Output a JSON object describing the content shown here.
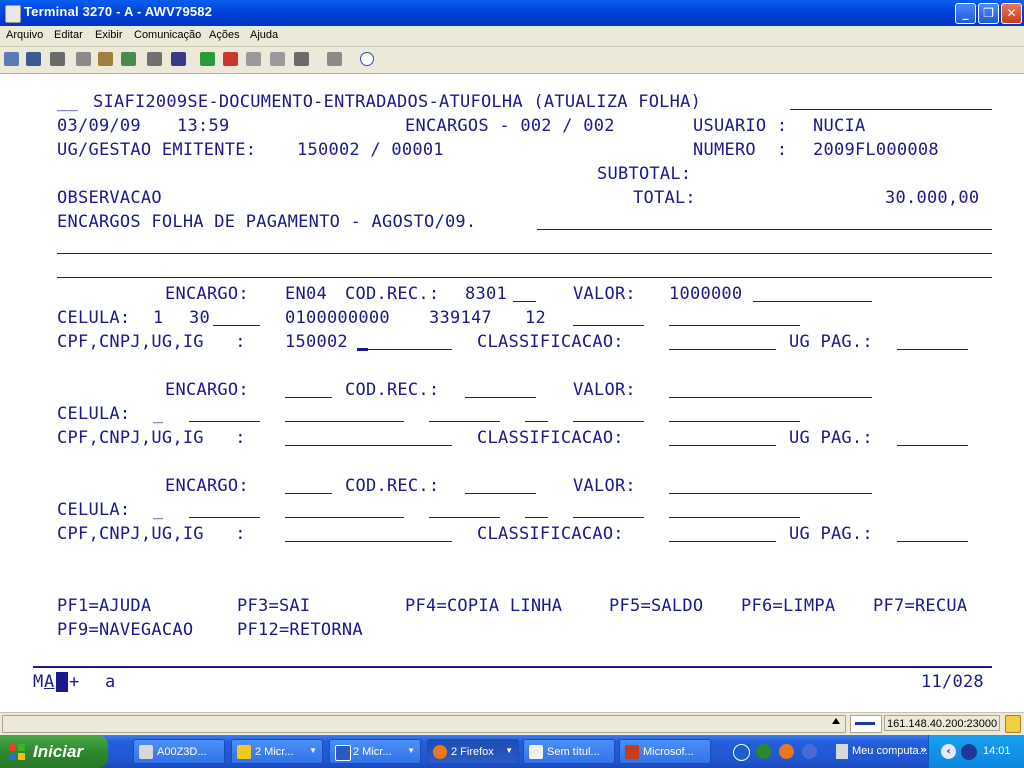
{
  "window": {
    "title": "Terminal 3270 - A - AWV79582",
    "buttons": [
      "_",
      "❐",
      "✕"
    ]
  },
  "menu": [
    "Arquivo",
    "Editar",
    "Exibir",
    "Comunicação",
    "Ações",
    "Ajuda"
  ],
  "toolbar_icons": [
    "new-session-icon",
    "save-icon",
    "print-icon",
    "copy-icon",
    "paste-icon",
    "cut-icon",
    "macro-icon",
    "keypad-icon",
    "send-icon",
    "receive-icon",
    "disconnect-icon",
    "connect-icon",
    "transfer-icon",
    "settings-icon",
    "help-icon"
  ],
  "screen": {
    "row1": {
      "prefix": "__",
      "title": "SIAFI2009SE-DOCUMENTO-ENTRADADOS-ATUFOLHA (ATUALIZA FOLHA)"
    },
    "row2": {
      "date": "03/09/09",
      "time": "13:59",
      "encargos": "ENCARGOS - 002 / 002",
      "usuario_label": "USUARIO :",
      "usuario": "NUCIA"
    },
    "row3": {
      "ug_label": "UG/GESTAO EMITENTE:",
      "ug": "150002 / 00001",
      "numero_label": "NUMERO  :",
      "numero": "2009FL000008"
    },
    "row4": {
      "subtotal_label": "SUBTOTAL:"
    },
    "row5": {
      "observacao_label": "OBSERVACAO",
      "total_label": "TOTAL:",
      "total": "30.000,00"
    },
    "observacao_text": "ENCARGOS FOLHA DE PAGAMENTO - AGOSTO/09.",
    "labels": {
      "encargo": "ENCARGO:",
      "cod_rec": "COD.REC.:",
      "valor": "VALOR:",
      "celula": "CELULA:",
      "cpf": "CPF,CNPJ,UG,IG   :",
      "classificacao": "CLASSIFICACAO:",
      "ug_pag": "UG PAG.:"
    },
    "block1": {
      "encargo": "EN04",
      "cod_rec": "8301",
      "valor": "1000000",
      "celula_1": "1",
      "celula_2": "30",
      "celula_3": "0100000000",
      "celula_4": "339147",
      "celula_5": "12",
      "cpf": "150002"
    },
    "block2_celula_prefix": "_",
    "block3_celula_prefix": "_",
    "pf_keys_row1": [
      "PF1=AJUDA",
      "PF3=SAI",
      "PF4=COPIA LINHA",
      "PF5=SALDO",
      "PF6=LIMPA",
      "PF7=RECUA"
    ],
    "pf_keys_row2": [
      "PF9=NAVEGACAO",
      "PF12=RETORNA"
    ],
    "oia": {
      "left1": "M",
      "left2": "A",
      "plus": "+",
      "mode": "a",
      "cursor_pos": "11/028"
    }
  },
  "statusbar": {
    "host": "161.148.40.200:23000"
  },
  "taskbar": {
    "start": "Iniciar",
    "tasks": [
      {
        "label": "A00Z3D...",
        "color": "#d8d8d8",
        "dropdown": false
      },
      {
        "label": "2 Micr...",
        "color": "#f0c820",
        "dropdown": true
      },
      {
        "label": "2 Micr...",
        "color": "#2a5ac8",
        "dropdown": true
      },
      {
        "label": "2 Firefox",
        "color": "#e87818",
        "dropdown": true
      },
      {
        "label": "Sem títul...",
        "color": "#f0f0f0",
        "dropdown": false
      },
      {
        "label": "Microsof...",
        "color": "#c83a1a",
        "dropdown": false
      }
    ],
    "tray_label": "Meu computa...",
    "clock": "14:01"
  }
}
